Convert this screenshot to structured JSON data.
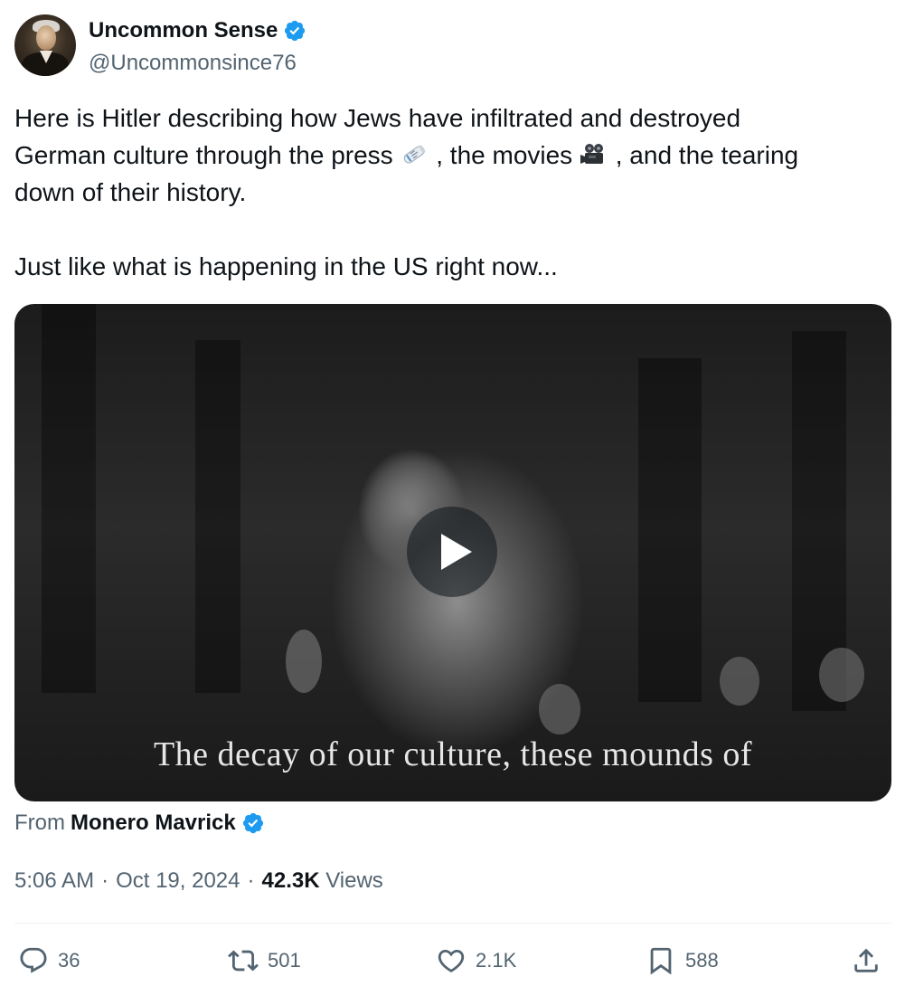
{
  "author": {
    "display_name": "Uncommon Sense",
    "handle": "@Uncommonsince76",
    "avatar_icon": "portrait-avatar",
    "verified_icon": "verified-badge-icon",
    "verified_color": "#1d9bf0"
  },
  "tweet": {
    "text_line_1": "Here is Hitler describing how Jews have infiltrated and destroyed",
    "text_line_2a": "German culture through the press ",
    "text_line_2b": " , the movies ",
    "text_line_2c": " , and the tearing",
    "text_line_3": "down of their history.",
    "text_line_5": "Just like what is happening in the US right now...",
    "emoji_1": "newspaper-roll-emoji",
    "emoji_2": "movie-camera-emoji"
  },
  "media": {
    "type": "video",
    "play_icon": "play-icon",
    "subtitle": "The decay of our culture, these mounds of"
  },
  "source": {
    "label": "From",
    "name": "Monero Mavrick"
  },
  "meta": {
    "time": "5:06 AM",
    "sep1": "·",
    "date": "Oct 19, 2024",
    "sep2": "·",
    "views_count": "42.3K",
    "views_label": "Views"
  },
  "actions": {
    "reply": {
      "icon": "reply-icon",
      "count": "36"
    },
    "retweet": {
      "icon": "retweet-icon",
      "count": "501"
    },
    "like": {
      "icon": "heart-icon",
      "count": "2.1K"
    },
    "bookmark": {
      "icon": "bookmark-icon",
      "count": "588"
    },
    "share": {
      "icon": "share-icon"
    }
  },
  "colors": {
    "text_primary": "#0f1419",
    "text_secondary": "#536471",
    "accent": "#1d9bf0"
  }
}
